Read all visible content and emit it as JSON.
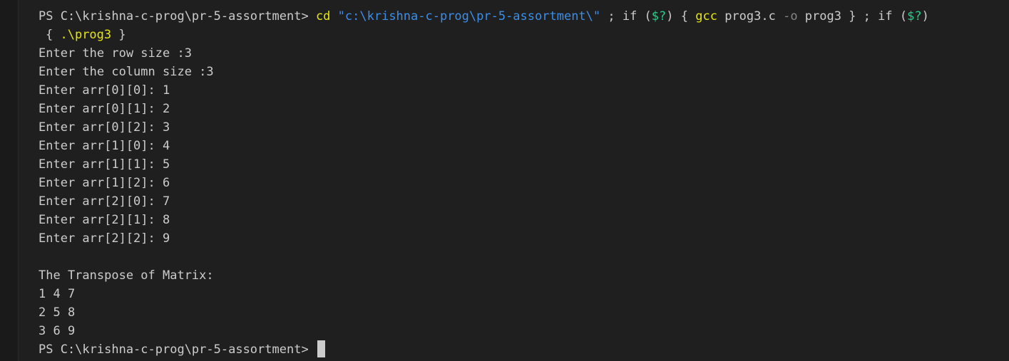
{
  "terminal": {
    "command_line": {
      "prompt": "PS C:\\krishna-c-prog\\pr-5-assortment> ",
      "cd": "cd",
      "path_str": "\"c:\\krishna-c-prog\\pr-5-assortment\\\"",
      "sep1": " ; if (",
      "var1": "$?",
      "mid1": ") { ",
      "gcc": "gcc",
      "gcc_args_a": " prog3.c ",
      "flag_o": "-o",
      "gcc_args_b": " prog3 } ; if (",
      "var2": "$?",
      "end1": ")"
    },
    "continuation": {
      "open": "{ ",
      "run": ".\\prog3",
      "close": " }"
    },
    "output_lines": [
      "Enter the row size :3",
      "Enter the column size :3",
      "Enter arr[0][0]: 1",
      "Enter arr[0][1]: 2",
      "Enter arr[0][2]: 3",
      "Enter arr[1][0]: 4",
      "Enter arr[1][1]: 5",
      "Enter arr[1][2]: 6",
      "Enter arr[2][0]: 7",
      "Enter arr[2][1]: 8",
      "Enter arr[2][2]: 9",
      "",
      "The Transpose of Matrix:",
      "1 4 7",
      "2 5 8",
      "3 6 9"
    ],
    "final_prompt": "PS C:\\krishna-c-prog\\pr-5-assortment> "
  },
  "colors": {
    "background": "#1f1f1f",
    "text": "#cccccc",
    "command": "#e5e510",
    "string": "#3b8eea",
    "variable": "#23d18b",
    "flag": "#858585"
  }
}
